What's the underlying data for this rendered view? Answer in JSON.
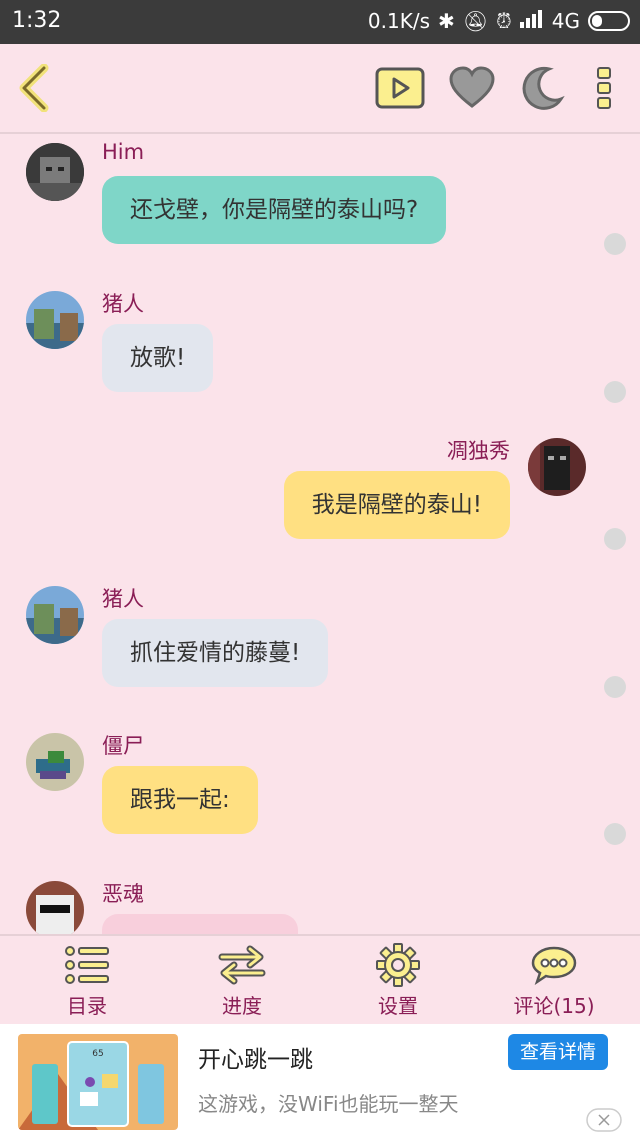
{
  "status_bar": {
    "time": "1:32",
    "net_speed": "0.1K/s",
    "network": "4G",
    "battery": "3"
  },
  "top_bar": {
    "back_icon": "chevron-left-icon",
    "play_icon": "play-icon",
    "favorite_icon": "heart-icon",
    "night_icon": "moon-icon",
    "more_icon": "more-vertical-icon",
    "accent": "#f1e27a"
  },
  "messages": [
    {
      "sender": "Him",
      "text": "还戈壁，你是隔壁的泰山吗?",
      "side": "left",
      "bubble_color": "#7fd6c8"
    },
    {
      "sender": "猪人",
      "text": "放歌!",
      "side": "left",
      "bubble_color": "#e2e6ee"
    },
    {
      "sender": "凋独秀",
      "text": "我是隔壁的泰山!",
      "side": "right",
      "bubble_color": "#ffe082"
    },
    {
      "sender": "猪人",
      "text": "抓住爱情的藤蔓!",
      "side": "left",
      "bubble_color": "#e2e6ee"
    },
    {
      "sender": "僵尸",
      "text": "跟我一起:",
      "side": "left",
      "bubble_color": "#ffe082"
    },
    {
      "sender": "恶魂",
      "text": "",
      "side": "left",
      "bubble_color": "#f8cfdc"
    }
  ],
  "bottom_nav": [
    {
      "label": "目录",
      "icon": "list-icon"
    },
    {
      "label": "进度",
      "icon": "swap-arrows-icon"
    },
    {
      "label": "设置",
      "icon": "gear-icon"
    },
    {
      "label": "评论(15)",
      "icon": "comment-icon"
    }
  ],
  "ad": {
    "title": "开心跳一跳",
    "description": "这游戏，没WiFi也能玩一整天",
    "button": "查看详情",
    "score": "65"
  }
}
